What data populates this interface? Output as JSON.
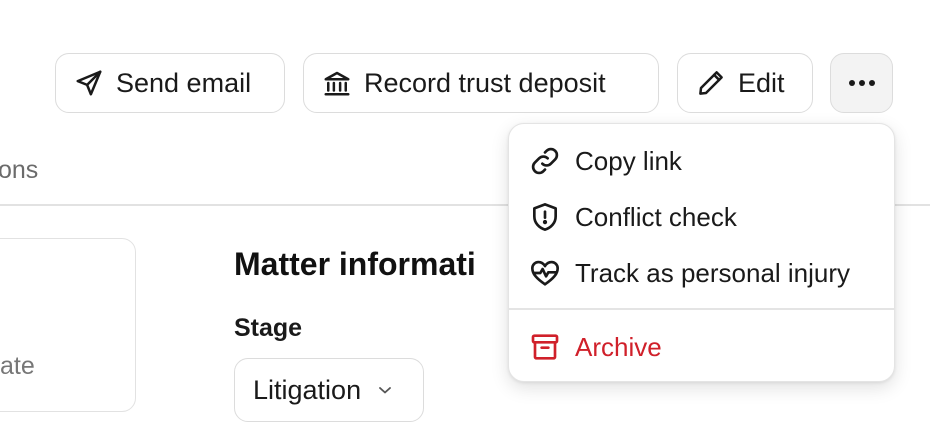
{
  "toolbar": {
    "send_email_label": "Send email",
    "record_trust_deposit_label": "Record trust deposit",
    "edit_label": "Edit"
  },
  "tabs": {
    "partial_tab_label": "ons"
  },
  "left_card": {
    "partial_text": "ate"
  },
  "matter_info": {
    "title": "Matter informati",
    "stage_label": "Stage",
    "stage_value": "Litigation"
  },
  "more_menu": {
    "items": [
      {
        "label": "Copy link",
        "icon": "link-icon"
      },
      {
        "label": "Conflict check",
        "icon": "shield-alert-icon"
      },
      {
        "label": "Track as personal injury",
        "icon": "heart-pulse-icon"
      },
      {
        "label": "Archive",
        "icon": "archive-icon",
        "color": "#d0202a"
      }
    ]
  },
  "colors": {
    "danger": "#d0202a",
    "border": "#dcdcdc",
    "muted_text": "#6b6b6b"
  }
}
